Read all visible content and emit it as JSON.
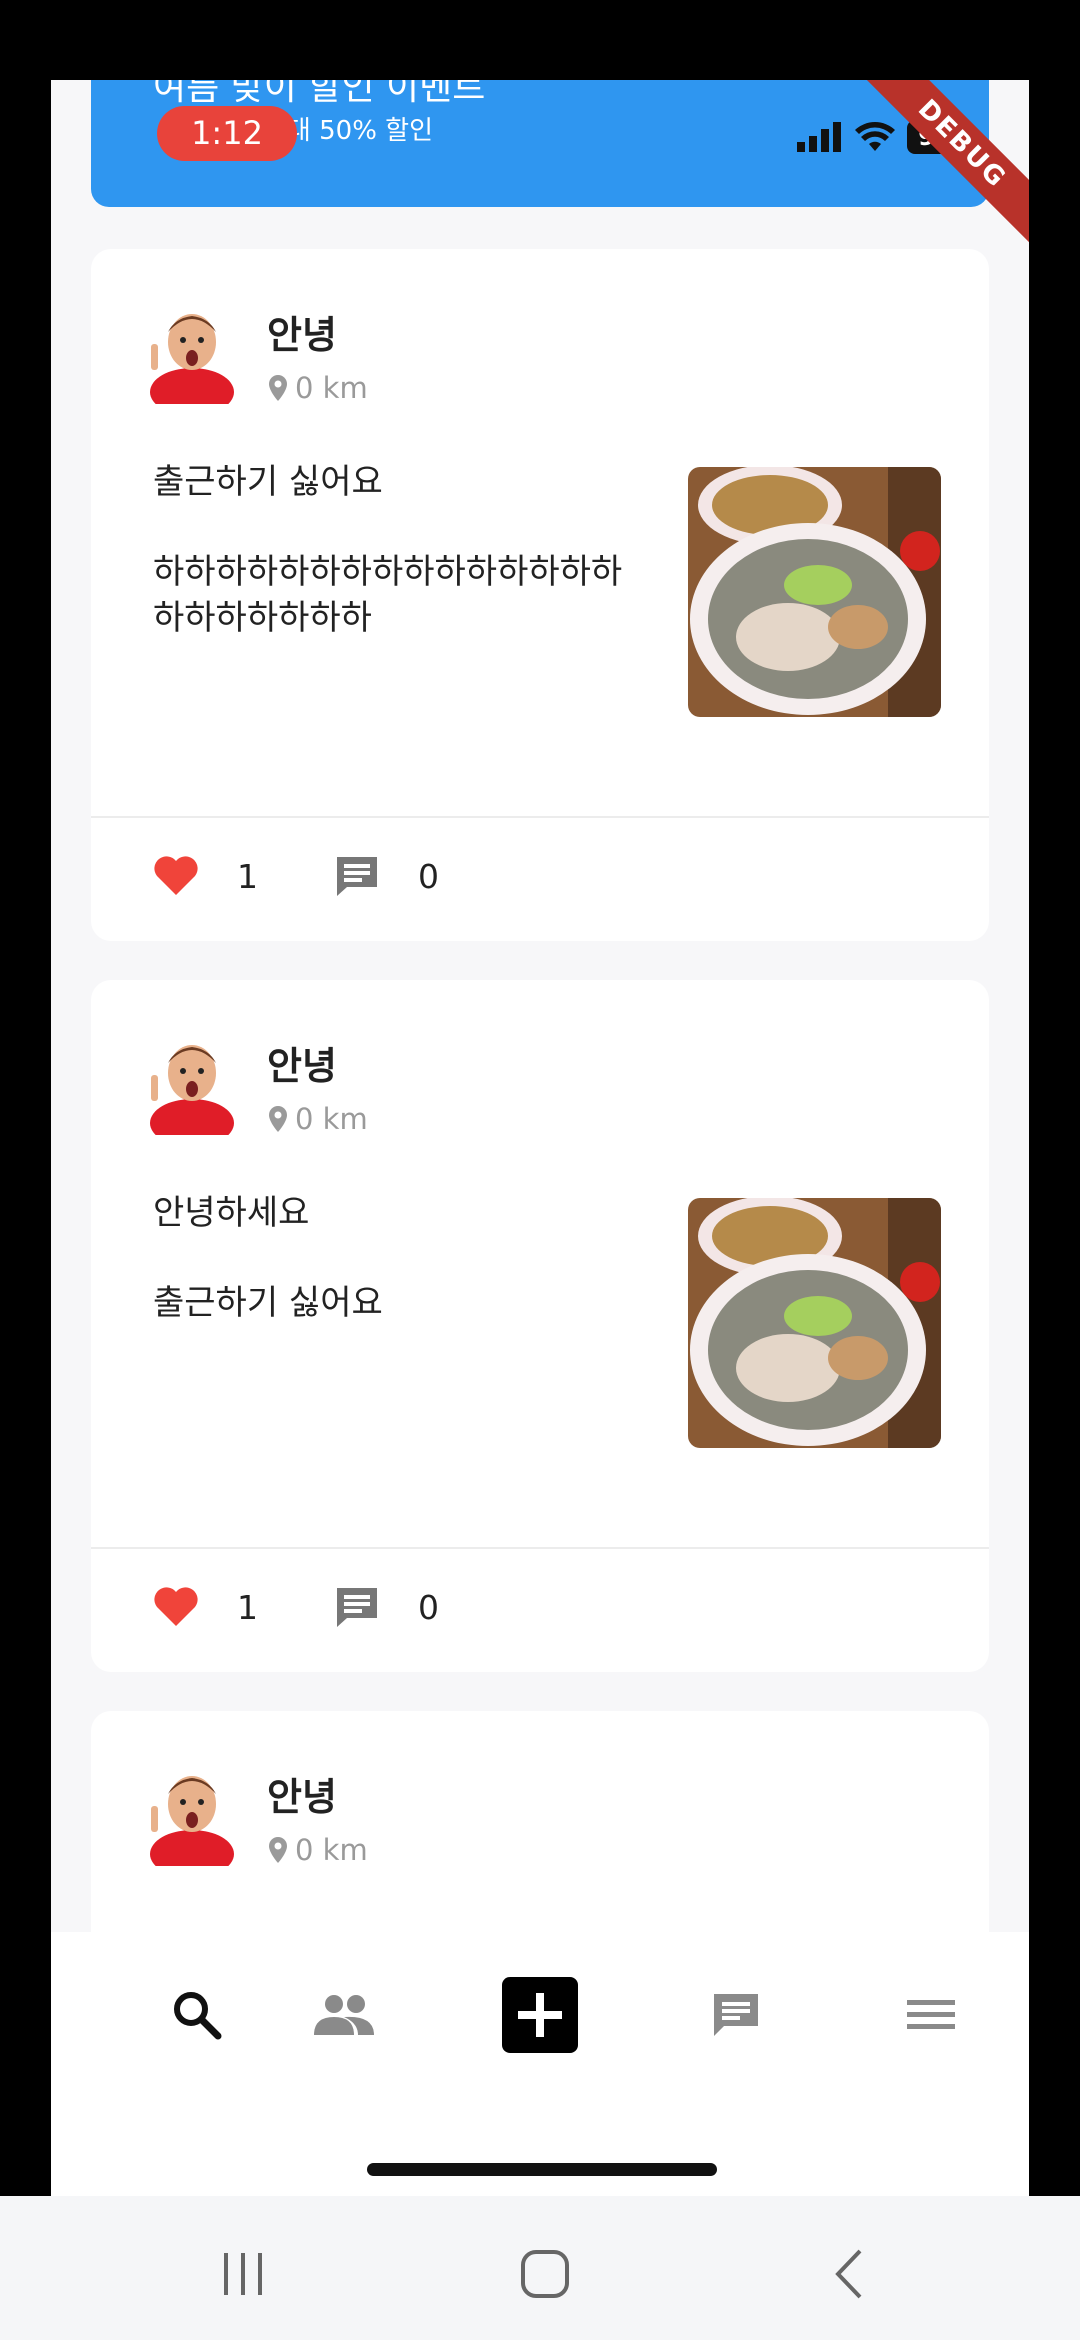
{
  "banner": {
    "title": "여름 맞이 할인 이벤트",
    "subtitle": "최대 50% 할인",
    "color": "#2f96f0"
  },
  "status_bar": {
    "time": "1:12",
    "battery": "97",
    "debug_label": "DEBUG"
  },
  "posts": [
    {
      "author": "안녕",
      "distance": "0 km",
      "paragraphs": [
        "출근하기 싫어요",
        "하하하하하하하하하하하하하하하하하하하하하하"
      ],
      "likes": "1",
      "comments": "0"
    },
    {
      "author": "안녕",
      "distance": "0 km",
      "paragraphs": [
        "안녕하세요",
        "출근하기 싫어요"
      ],
      "likes": "1",
      "comments": "0"
    },
    {
      "author": "안녕",
      "distance": "0 km"
    }
  ],
  "bottom_nav": {
    "items": [
      {
        "icon": "search-icon",
        "active": true
      },
      {
        "icon": "people-icon",
        "active": false
      },
      {
        "icon": "add-icon",
        "active": false
      },
      {
        "icon": "chat-icon",
        "active": false
      },
      {
        "icon": "menu-icon",
        "active": false
      }
    ]
  },
  "colors": {
    "like": "#f0443a",
    "muted_icon": "#9a9a9a",
    "background": "#f7f7f9"
  }
}
